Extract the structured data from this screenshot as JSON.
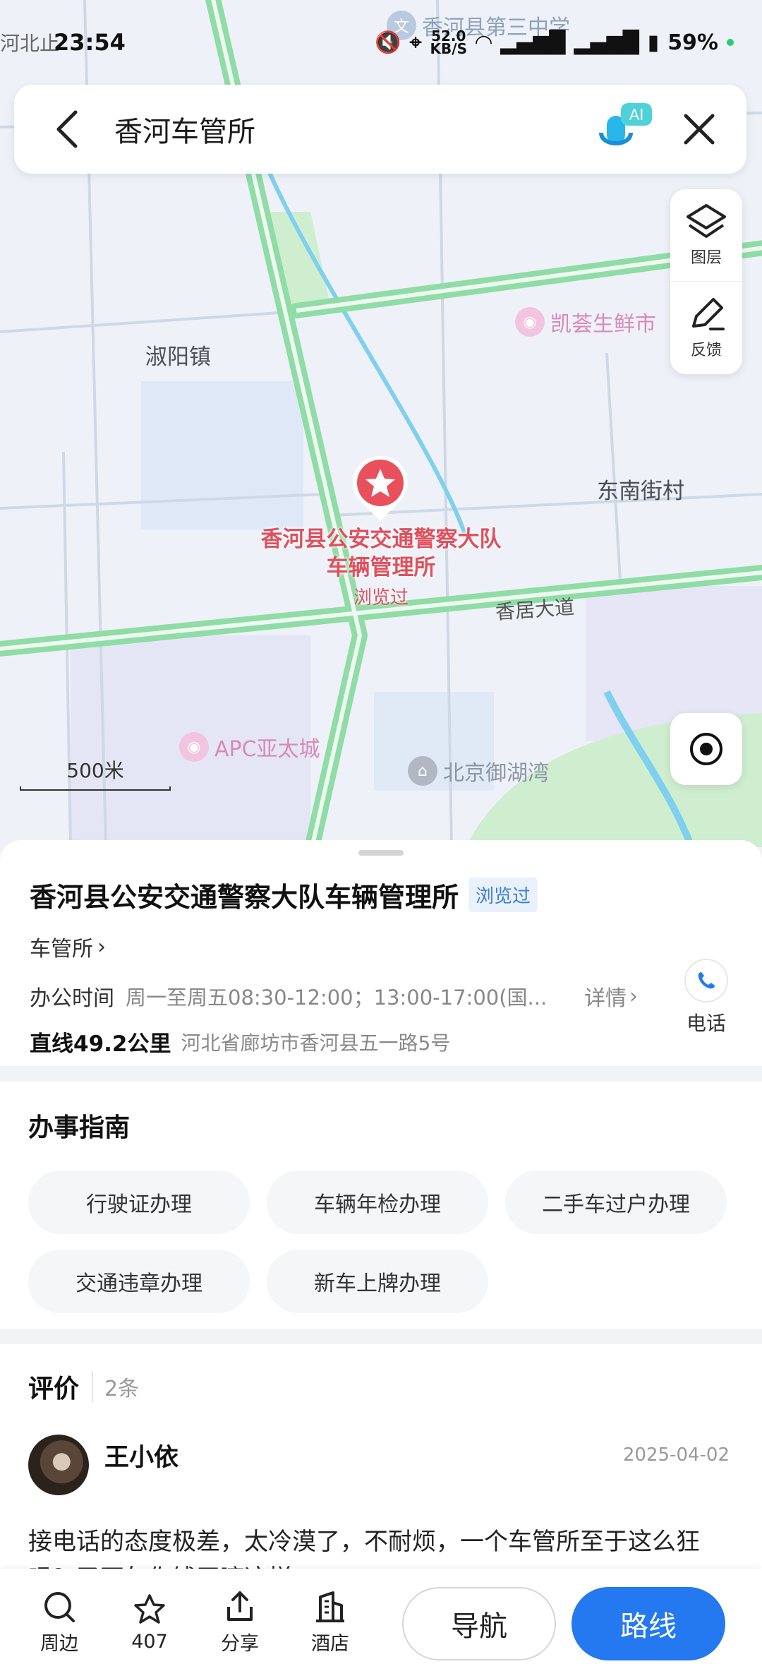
{
  "status_bar": {
    "carrier_text": "河北止",
    "time": "23:54",
    "net_speed": "52.0",
    "net_unit": "KB/S",
    "battery": "59%"
  },
  "search": {
    "query": "香河车管所"
  },
  "map_tools": {
    "layers_label": "图层",
    "feedback_label": "反馈"
  },
  "map": {
    "top_poi": "香河县第三中学",
    "town_label": "淑阳镇",
    "village_label": "东南街村",
    "road_label": "香居大道",
    "poi_market": "凯荟生鲜市",
    "poi_mall": "APC亚太城",
    "poi_residence": "北京御湖湾",
    "marker_name": "香河县公安交通警察大队车辆管理所",
    "marker_visited": "浏览过",
    "scale_label": "500米"
  },
  "place": {
    "name": "香河县公安交通警察大队车辆管理所",
    "visited_badge": "浏览过",
    "category": "车管所",
    "hours_label": "办公时间",
    "hours_value": "周一至周五08:30-12:00；13:00-17:00(国...",
    "details_label": "详情",
    "distance": "直线49.2公里",
    "address": "河北省廊坊市香河县五一路5号",
    "phone_label": "电话"
  },
  "guide": {
    "title": "办事指南",
    "items": [
      "行驶证办理",
      "车辆年检办理",
      "二手车过户办理",
      "交通违章办理",
      "新车上牌办理"
    ]
  },
  "reviews": {
    "title": "评价",
    "count": "2条",
    "items": [
      {
        "user": "王小依",
        "date": "2025-04-02",
        "text": "接电话的态度极差，太冷漠了，不耐烦，一个车管所至于这么狂吗？又不欠你钱干嘛这样"
      }
    ]
  },
  "bottom_bar": {
    "nearby": "周边",
    "favorite_count": "407",
    "share": "分享",
    "hotel": "酒店",
    "navigate": "导航",
    "route": "路线"
  },
  "colors": {
    "accent_blue": "#2478f0",
    "marker_red": "#e0505e",
    "road_green": "#8fdca6"
  }
}
